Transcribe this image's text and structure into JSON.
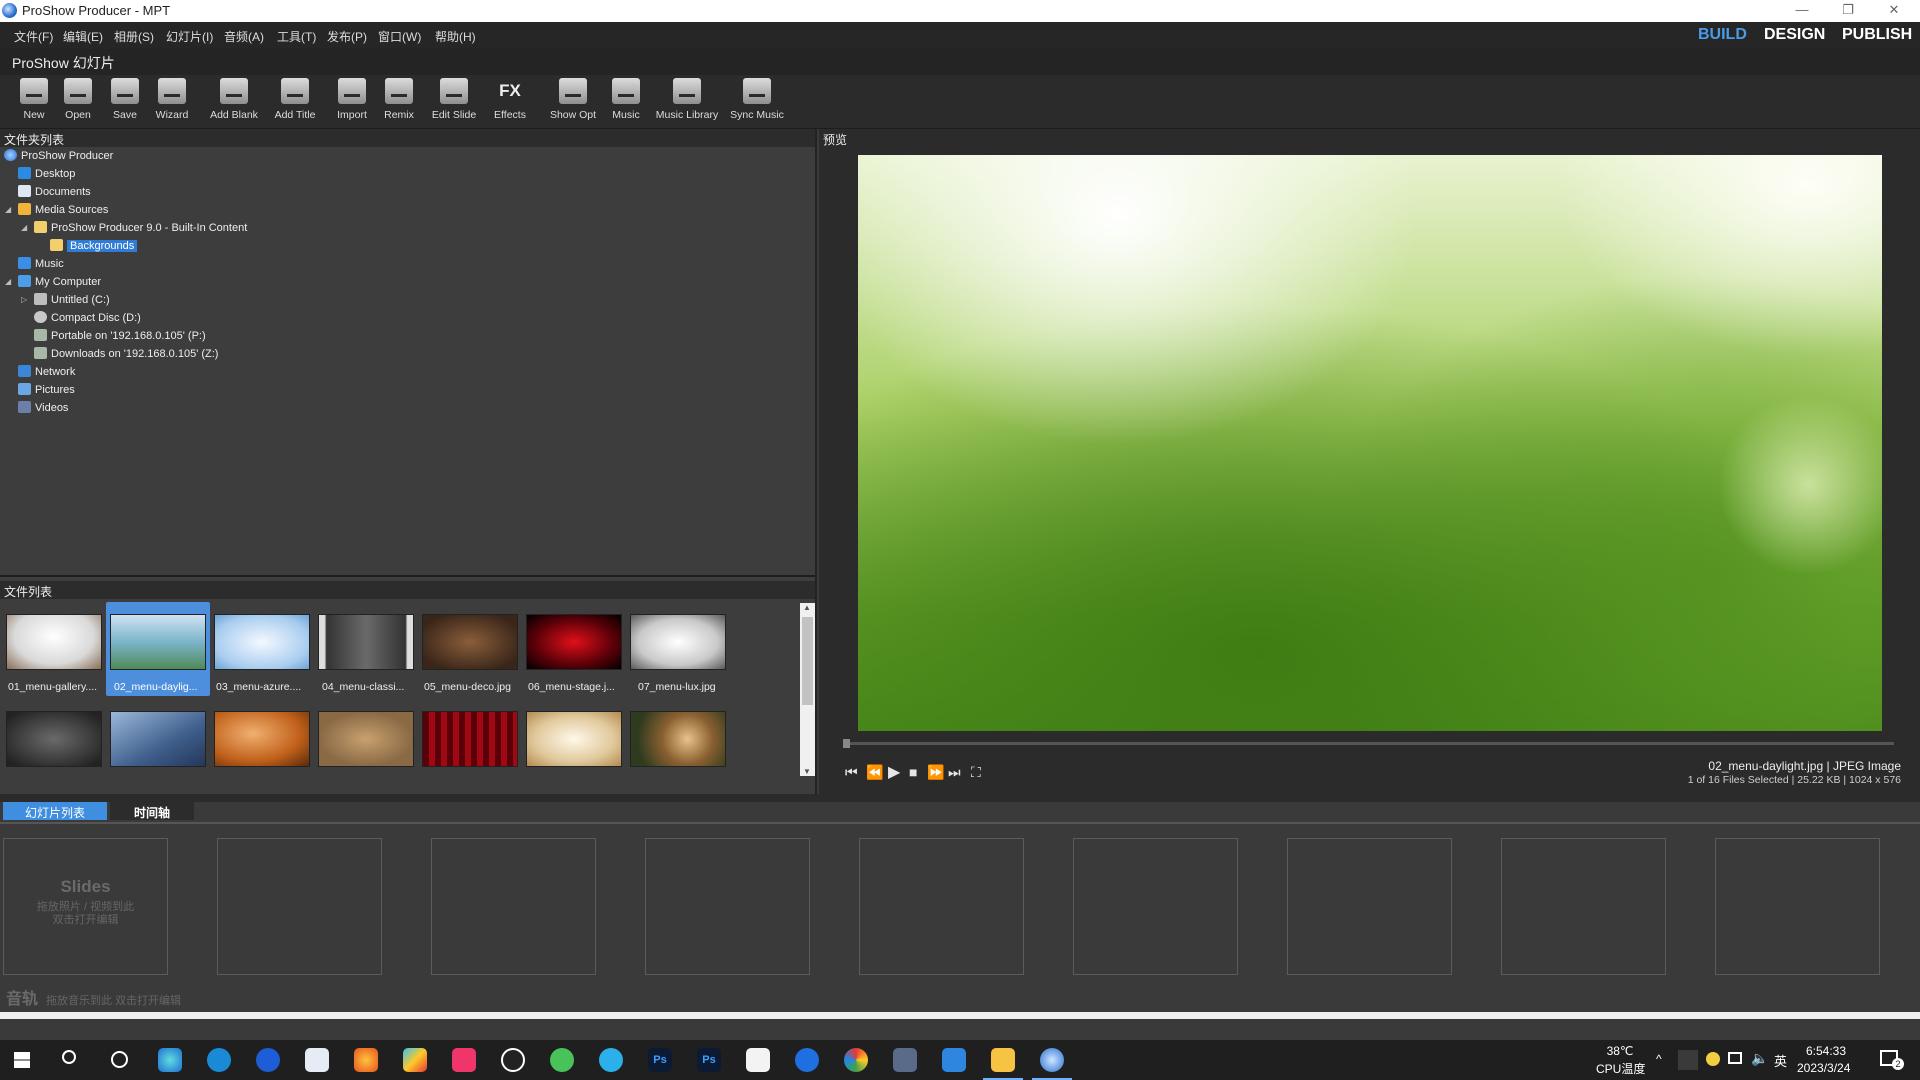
{
  "window": {
    "title": "ProShow Producer - MPT",
    "minimize": "—",
    "restore": "❐",
    "close": "✕"
  },
  "menu": [
    "文件(F)",
    "编辑(E)",
    "相册(S)",
    "幻灯片(I)",
    "音频(A)",
    "工具(T)",
    "发布(P)",
    "窗口(W)",
    "帮助(H)"
  ],
  "modes": {
    "build": "BUILD",
    "design": "DESIGN",
    "publish": "PUBLISH"
  },
  "app_label": "ProShow 幻灯片",
  "toolbar": [
    {
      "label": "New",
      "icon": "new-icon"
    },
    {
      "label": "Open",
      "icon": "open-folder-icon"
    },
    {
      "label": "Save",
      "icon": "save-icon"
    },
    {
      "label": "Wizard",
      "icon": "wizard-icon"
    },
    {
      "label": "Add Blank",
      "icon": "add-blank-icon"
    },
    {
      "label": "Add Title",
      "icon": "add-title-icon"
    },
    {
      "label": "Import",
      "icon": "import-icon"
    },
    {
      "label": "Remix",
      "icon": "remix-icon"
    },
    {
      "label": "Edit Slide",
      "icon": "edit-slide-icon"
    },
    {
      "label": "Effects",
      "icon": "effects-icon",
      "glyph": "FX"
    },
    {
      "label": "Show Opt",
      "icon": "show-options-icon"
    },
    {
      "label": "Music",
      "icon": "music-icon"
    },
    {
      "label": "Music Library",
      "icon": "music-library-icon"
    },
    {
      "label": "Sync Music",
      "icon": "sync-music-icon"
    }
  ],
  "folders": {
    "header": "文件夹列表",
    "items": [
      "ProShow Producer",
      "Desktop",
      "Documents",
      "Media Sources",
      "ProShow Producer 9.0 - Built-In Content",
      "Backgrounds",
      "Music",
      "My Computer",
      "Untitled (C:)",
      "Compact Disc (D:)",
      "Portable on '192.168.0.105' (P:)",
      "Downloads on '192.168.0.105' (Z:)",
      "Network",
      "Pictures",
      "Videos"
    ]
  },
  "files": {
    "header": "文件列表",
    "row1": [
      "01_menu-gallery....",
      "02_menu-daylig...",
      "03_menu-azure....",
      "04_menu-classi...",
      "05_menu-deco.jpg",
      "06_menu-stage.j...",
      "07_menu-lux.jpg"
    ]
  },
  "preview": {
    "header": "预览",
    "filename": "02_menu-daylight.jpg",
    "type": "JPEG Image",
    "selection": "1 of 16 Files Selected",
    "size": "25.22 KB",
    "dims": "1024 x 576",
    "sep": "|"
  },
  "timeline": {
    "tab_slides": "幻灯片列表",
    "tab_timeline": "时间轴",
    "slides_title": "Slides",
    "slides_hint1": "拖放照片 / 视频到此",
    "slides_hint2": "双击打开编辑",
    "audio_title": "音轨",
    "audio_hint": "拖放音乐到此  双击打开编辑"
  },
  "taskbar": {
    "temp": "38℃",
    "temp_label": "CPU温度",
    "time": "6:54:33",
    "date": "2023/3/24",
    "ime": "英",
    "notif": "2"
  }
}
